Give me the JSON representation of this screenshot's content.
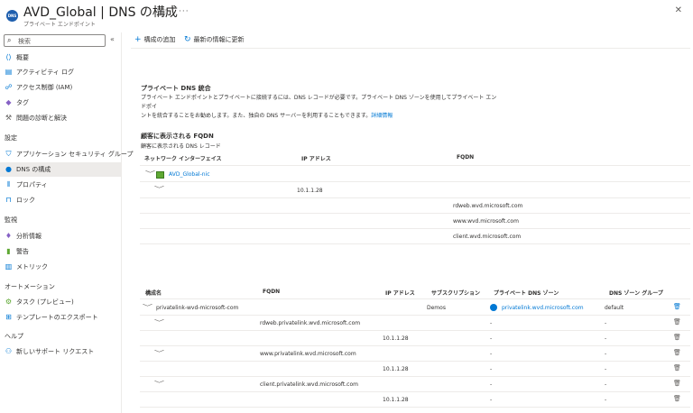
{
  "header": {
    "icon_text": "DNS",
    "title": "AVD_Global | DNS の構成",
    "subtitle": "プライベート エンドポイント",
    "star": "☆",
    "more": "···",
    "close": "✕"
  },
  "sidebar": {
    "search_placeholder": "検索",
    "collapse": "«",
    "items": [
      {
        "label": "概要"
      },
      {
        "label": "アクティビティ ログ"
      },
      {
        "label": "アクセス制御 (IAM)"
      },
      {
        "label": "タグ"
      },
      {
        "label": "問題の診断と解決"
      }
    ],
    "section_settings": "設定",
    "settings_items": [
      {
        "label": "アプリケーション セキュリティ グループ"
      },
      {
        "label": "DNS の構成"
      },
      {
        "label": "プロパティ"
      },
      {
        "label": "ロック"
      }
    ],
    "section_monitoring": "監視",
    "monitoring_items": [
      {
        "label": "分析情報"
      },
      {
        "label": "警告"
      },
      {
        "label": "メトリック"
      }
    ],
    "section_automation": "オートメーション",
    "automation_items": [
      {
        "label": "タスク (プレビュー)"
      },
      {
        "label": "テンプレートのエクスポート"
      }
    ],
    "section_help": "ヘルプ",
    "help_items": [
      {
        "label": "新しいサポート リクエスト"
      }
    ]
  },
  "toolbar": {
    "add_label": "構成の追加",
    "refresh_label": "最新の情報に更新"
  },
  "private_dns": {
    "title": "プライベート DNS 統合",
    "desc_line1": "プライベート エンドポイントとプライベートに接続するには、DNS レコードが必要です。プライベート DNS ゾーンを使用してプライベート エンドポイ",
    "desc_line2": "ントを統合することをお勧めします。また、独自の DNS サーバーを利用することもできます。",
    "desc_link": "詳細情報"
  },
  "fqdn": {
    "title": "顧客に表示される FQDN",
    "subtitle": "顧客に表示される DNS レコード",
    "headers": {
      "nic": "ネットワーク インターフェイス",
      "ip": "IP アドレス",
      "fqdn": "FQDN"
    },
    "nic_name": "AVD_Global-nic",
    "ip": "10.1.1.28",
    "fqdns": [
      "rdweb.wvd.microsoft.com",
      "www.wvd.microsoft.com",
      "client.wvd.microsoft.com"
    ]
  },
  "config": {
    "headers": {
      "name": "構成名",
      "fqdn": "FQDN",
      "ip": "IP アドレス",
      "subscription": "サブスクリプション",
      "zone": "プライベート DNS ゾーン",
      "group": "DNS ゾーン グループ"
    },
    "name": "privatelink-wvd-microsoft-com",
    "subscription": "Demos",
    "zone": "privatelink.wvd.microsoft.com",
    "group": "default",
    "rows": [
      {
        "fqdn": "rdweb.privatelink.wvd.microsoft.com",
        "ip": "10.1.1.28",
        "dash": "-"
      },
      {
        "fqdn": "www.privatelink.wvd.microsoft.com",
        "ip": "10.1.1.28",
        "dash": "-"
      },
      {
        "fqdn": "client.privatelink.wvd.microsoft.com",
        "ip": "10.1.1.28",
        "dash": "-"
      }
    ]
  },
  "icons": {
    "chevron": "﹀",
    "trash": "🗑"
  },
  "colors": {
    "accent": "#0078d4",
    "active_bg": "#edebe9"
  }
}
